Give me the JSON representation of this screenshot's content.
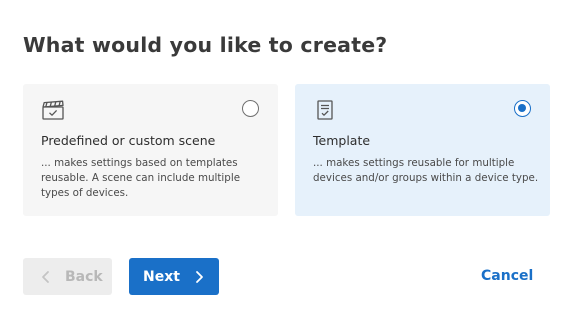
{
  "dialog": {
    "title": "What would you like to create?"
  },
  "options": [
    {
      "icon": "clapperboard-icon",
      "title": "Predefined or custom scene",
      "description": "... makes settings based on templates reusable. A scene can include multiple types of devices.",
      "selected": false
    },
    {
      "icon": "template-checklist-icon",
      "title": "Template",
      "description": "... makes settings reusable for multiple devices and/or groups within a device type.",
      "selected": true
    }
  ],
  "footer": {
    "back_label": "Back",
    "back_disabled": true,
    "next_label": "Next",
    "cancel_label": "Cancel"
  },
  "colors": {
    "accent": "#1a70c8",
    "selected_card_bg": "#e6f1fb",
    "card_bg": "#f6f6f6",
    "disabled_button_bg": "#ededed"
  }
}
